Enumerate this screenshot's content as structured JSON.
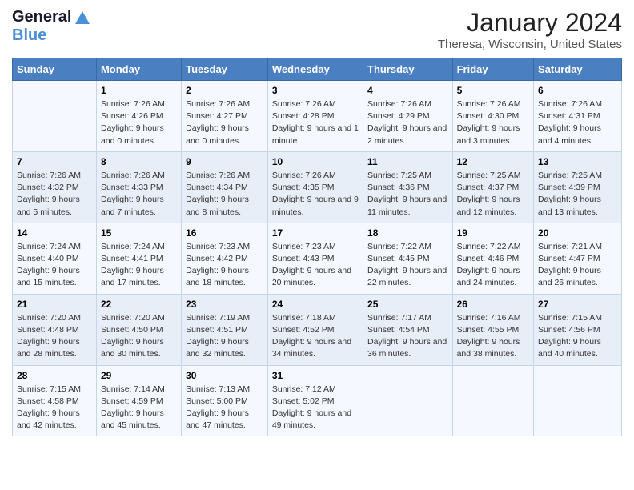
{
  "header": {
    "logo_general": "General",
    "logo_blue": "Blue",
    "title": "January 2024",
    "subtitle": "Theresa, Wisconsin, United States"
  },
  "days_of_week": [
    "Sunday",
    "Monday",
    "Tuesday",
    "Wednesday",
    "Thursday",
    "Friday",
    "Saturday"
  ],
  "weeks": [
    [
      {
        "day": "",
        "sunrise": "",
        "sunset": "",
        "daylight": ""
      },
      {
        "day": "1",
        "sunrise": "Sunrise: 7:26 AM",
        "sunset": "Sunset: 4:26 PM",
        "daylight": "Daylight: 9 hours and 0 minutes."
      },
      {
        "day": "2",
        "sunrise": "Sunrise: 7:26 AM",
        "sunset": "Sunset: 4:27 PM",
        "daylight": "Daylight: 9 hours and 0 minutes."
      },
      {
        "day": "3",
        "sunrise": "Sunrise: 7:26 AM",
        "sunset": "Sunset: 4:28 PM",
        "daylight": "Daylight: 9 hours and 1 minute."
      },
      {
        "day": "4",
        "sunrise": "Sunrise: 7:26 AM",
        "sunset": "Sunset: 4:29 PM",
        "daylight": "Daylight: 9 hours and 2 minutes."
      },
      {
        "day": "5",
        "sunrise": "Sunrise: 7:26 AM",
        "sunset": "Sunset: 4:30 PM",
        "daylight": "Daylight: 9 hours and 3 minutes."
      },
      {
        "day": "6",
        "sunrise": "Sunrise: 7:26 AM",
        "sunset": "Sunset: 4:31 PM",
        "daylight": "Daylight: 9 hours and 4 minutes."
      }
    ],
    [
      {
        "day": "7",
        "sunrise": "Sunrise: 7:26 AM",
        "sunset": "Sunset: 4:32 PM",
        "daylight": "Daylight: 9 hours and 5 minutes."
      },
      {
        "day": "8",
        "sunrise": "Sunrise: 7:26 AM",
        "sunset": "Sunset: 4:33 PM",
        "daylight": "Daylight: 9 hours and 7 minutes."
      },
      {
        "day": "9",
        "sunrise": "Sunrise: 7:26 AM",
        "sunset": "Sunset: 4:34 PM",
        "daylight": "Daylight: 9 hours and 8 minutes."
      },
      {
        "day": "10",
        "sunrise": "Sunrise: 7:26 AM",
        "sunset": "Sunset: 4:35 PM",
        "daylight": "Daylight: 9 hours and 9 minutes."
      },
      {
        "day": "11",
        "sunrise": "Sunrise: 7:25 AM",
        "sunset": "Sunset: 4:36 PM",
        "daylight": "Daylight: 9 hours and 11 minutes."
      },
      {
        "day": "12",
        "sunrise": "Sunrise: 7:25 AM",
        "sunset": "Sunset: 4:37 PM",
        "daylight": "Daylight: 9 hours and 12 minutes."
      },
      {
        "day": "13",
        "sunrise": "Sunrise: 7:25 AM",
        "sunset": "Sunset: 4:39 PM",
        "daylight": "Daylight: 9 hours and 13 minutes."
      }
    ],
    [
      {
        "day": "14",
        "sunrise": "Sunrise: 7:24 AM",
        "sunset": "Sunset: 4:40 PM",
        "daylight": "Daylight: 9 hours and 15 minutes."
      },
      {
        "day": "15",
        "sunrise": "Sunrise: 7:24 AM",
        "sunset": "Sunset: 4:41 PM",
        "daylight": "Daylight: 9 hours and 17 minutes."
      },
      {
        "day": "16",
        "sunrise": "Sunrise: 7:23 AM",
        "sunset": "Sunset: 4:42 PM",
        "daylight": "Daylight: 9 hours and 18 minutes."
      },
      {
        "day": "17",
        "sunrise": "Sunrise: 7:23 AM",
        "sunset": "Sunset: 4:43 PM",
        "daylight": "Daylight: 9 hours and 20 minutes."
      },
      {
        "day": "18",
        "sunrise": "Sunrise: 7:22 AM",
        "sunset": "Sunset: 4:45 PM",
        "daylight": "Daylight: 9 hours and 22 minutes."
      },
      {
        "day": "19",
        "sunrise": "Sunrise: 7:22 AM",
        "sunset": "Sunset: 4:46 PM",
        "daylight": "Daylight: 9 hours and 24 minutes."
      },
      {
        "day": "20",
        "sunrise": "Sunrise: 7:21 AM",
        "sunset": "Sunset: 4:47 PM",
        "daylight": "Daylight: 9 hours and 26 minutes."
      }
    ],
    [
      {
        "day": "21",
        "sunrise": "Sunrise: 7:20 AM",
        "sunset": "Sunset: 4:48 PM",
        "daylight": "Daylight: 9 hours and 28 minutes."
      },
      {
        "day": "22",
        "sunrise": "Sunrise: 7:20 AM",
        "sunset": "Sunset: 4:50 PM",
        "daylight": "Daylight: 9 hours and 30 minutes."
      },
      {
        "day": "23",
        "sunrise": "Sunrise: 7:19 AM",
        "sunset": "Sunset: 4:51 PM",
        "daylight": "Daylight: 9 hours and 32 minutes."
      },
      {
        "day": "24",
        "sunrise": "Sunrise: 7:18 AM",
        "sunset": "Sunset: 4:52 PM",
        "daylight": "Daylight: 9 hours and 34 minutes."
      },
      {
        "day": "25",
        "sunrise": "Sunrise: 7:17 AM",
        "sunset": "Sunset: 4:54 PM",
        "daylight": "Daylight: 9 hours and 36 minutes."
      },
      {
        "day": "26",
        "sunrise": "Sunrise: 7:16 AM",
        "sunset": "Sunset: 4:55 PM",
        "daylight": "Daylight: 9 hours and 38 minutes."
      },
      {
        "day": "27",
        "sunrise": "Sunrise: 7:15 AM",
        "sunset": "Sunset: 4:56 PM",
        "daylight": "Daylight: 9 hours and 40 minutes."
      }
    ],
    [
      {
        "day": "28",
        "sunrise": "Sunrise: 7:15 AM",
        "sunset": "Sunset: 4:58 PM",
        "daylight": "Daylight: 9 hours and 42 minutes."
      },
      {
        "day": "29",
        "sunrise": "Sunrise: 7:14 AM",
        "sunset": "Sunset: 4:59 PM",
        "daylight": "Daylight: 9 hours and 45 minutes."
      },
      {
        "day": "30",
        "sunrise": "Sunrise: 7:13 AM",
        "sunset": "Sunset: 5:00 PM",
        "daylight": "Daylight: 9 hours and 47 minutes."
      },
      {
        "day": "31",
        "sunrise": "Sunrise: 7:12 AM",
        "sunset": "Sunset: 5:02 PM",
        "daylight": "Daylight: 9 hours and 49 minutes."
      },
      {
        "day": "",
        "sunrise": "",
        "sunset": "",
        "daylight": ""
      },
      {
        "day": "",
        "sunrise": "",
        "sunset": "",
        "daylight": ""
      },
      {
        "day": "",
        "sunrise": "",
        "sunset": "",
        "daylight": ""
      }
    ]
  ]
}
